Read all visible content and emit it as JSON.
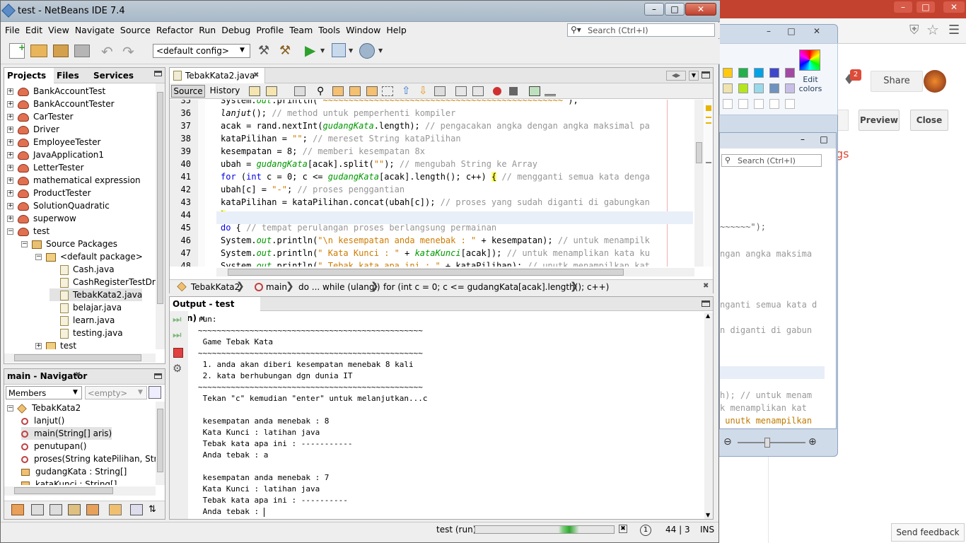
{
  "window": {
    "title": "test - NetBeans IDE 7.4"
  },
  "menu": [
    "File",
    "Edit",
    "View",
    "Navigate",
    "Source",
    "Refactor",
    "Run",
    "Debug",
    "Profile",
    "Team",
    "Tools",
    "Window",
    "Help"
  ],
  "search": {
    "placeholder": "Search (Ctrl+I)"
  },
  "toolbar": {
    "config": "<default config>"
  },
  "projects_panel": {
    "tabs": [
      "Projects",
      "Files",
      "Services"
    ],
    "items": [
      {
        "label": "BankAccountTest",
        "level": 0
      },
      {
        "label": "BankAccountTester",
        "level": 0
      },
      {
        "label": "CarTester",
        "level": 0
      },
      {
        "label": "Driver",
        "level": 0
      },
      {
        "label": "EmployeeTester",
        "level": 0
      },
      {
        "label": "JavaApplication1",
        "level": 0
      },
      {
        "label": "LetterTester",
        "level": 0
      },
      {
        "label": "mathematical expression",
        "level": 0
      },
      {
        "label": "ProductTester",
        "level": 0
      },
      {
        "label": "SolutionQuadratic",
        "level": 0
      },
      {
        "label": "superwow",
        "level": 0
      },
      {
        "label": "test",
        "level": 0
      },
      {
        "label": "Source Packages",
        "level": 1
      },
      {
        "label": "<default package>",
        "level": 2
      },
      {
        "label": "Cash.java",
        "level": 3
      },
      {
        "label": "CashRegisterTestDrive",
        "level": 3
      },
      {
        "label": "TebakKata2.java",
        "level": 3
      },
      {
        "label": "belajar.java",
        "level": 3
      },
      {
        "label": "learn.java",
        "level": 3
      },
      {
        "label": "testing.java",
        "level": 3
      },
      {
        "label": "test",
        "level": 2
      }
    ]
  },
  "navigator": {
    "title": "main - Navigator",
    "members_label": "Members",
    "filter_label": "<empty>",
    "items": [
      {
        "label": "TebakKata2",
        "level": 0
      },
      {
        "label": "lanjut()",
        "level": 1
      },
      {
        "label": "main(String[] aris)",
        "level": 1
      },
      {
        "label": "penutupan()",
        "level": 1
      },
      {
        "label": "proses(String katePilihan, Strin",
        "level": 1
      },
      {
        "label": "gudangKata : String[]",
        "level": 1
      },
      {
        "label": "kataKunci : String[]",
        "level": 1
      }
    ]
  },
  "editor": {
    "tab": "TebakKata2.java",
    "view_tabs": [
      "Source",
      "History"
    ],
    "line_numbers": [
      "35",
      "36",
      "37",
      "38",
      "39",
      "40",
      "41",
      "42",
      "43",
      "44",
      "45",
      "46",
      "47",
      "48"
    ],
    "breadcrumb": [
      "TebakKata2",
      "main",
      "do ... while (ulangi)",
      "for (int c = 0; c <= gudangKata[acak].length(); c++)"
    ]
  },
  "output": {
    "title": "Output - test (run)",
    "lines": [
      "run:",
      "~~~~~~~~~~~~~~~~~~~~~~~~~~~~~~~~~~~~~~~~~~~~~~~~",
      " Game Tebak Kata",
      "~~~~~~~~~~~~~~~~~~~~~~~~~~~~~~~~~~~~~~~~~~~~~~~~",
      " 1. anda akan diberi kesempatan menebak 8 kali",
      " 2. kata berhubungan dgn dunia IT",
      "~~~~~~~~~~~~~~~~~~~~~~~~~~~~~~~~~~~~~~~~~~~~~~~~",
      " Tekan \"c\" kemudian \"enter\" untuk melanjutkan...c",
      "",
      " kesempatan anda menebak : 8",
      " Kata Kunci : latihan java",
      " Tebak kata apa ini : -----------",
      " Anda tebak : a",
      "",
      " kesempatan anda menebak : 7",
      " Kata Kunci : latihan java",
      " Tebak kata apa ini : ----------",
      " Anda tebak : "
    ]
  },
  "status": {
    "run_label": "test (run)",
    "badge": "1",
    "position": "44 | 3",
    "mode": "INS"
  },
  "background": {
    "share_label": "Share",
    "notification_count": "2",
    "preview_label": "Preview",
    "close_label": "Close",
    "settings_fragment": "gs",
    "feedback_label": "Send feedback",
    "edit_colors_label": "Edit colors",
    "search_placeholder": "Search (Ctrl+I)",
    "code_fragments": [
      "~~~~~~\");",
      "ngan angka maksima",
      "nganti semua kata d",
      "n diganti di gabun",
      "h); // untuk menam",
      "k menamplikan kat",
      " unutk menampilkan"
    ]
  }
}
